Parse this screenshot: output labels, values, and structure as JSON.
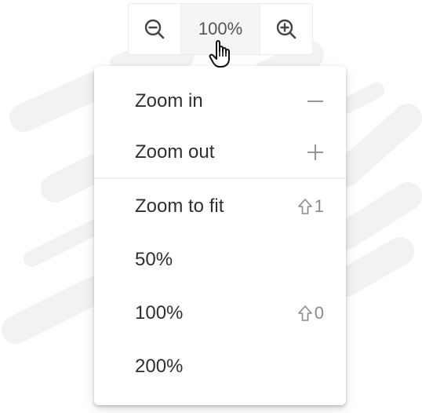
{
  "zoom_bar": {
    "level": "100%",
    "zoom_out_icon": "zoom-out-magnifier-icon",
    "zoom_in_icon": "zoom-in-magnifier-icon"
  },
  "cursor_icon": "hand-pointer-icon",
  "menu": {
    "items": [
      {
        "label": "Zoom in",
        "shortcut_icon": "minus-icon",
        "shortcut_key": ""
      },
      {
        "label": "Zoom out",
        "shortcut_icon": "plus-icon",
        "shortcut_key": ""
      },
      {
        "label": "Zoom to fit",
        "shortcut_icon": "shift-icon",
        "shortcut_key": "1"
      },
      {
        "label": "50%",
        "shortcut_icon": "",
        "shortcut_key": ""
      },
      {
        "label": "100%",
        "shortcut_icon": "shift-icon",
        "shortcut_key": "0"
      },
      {
        "label": "200%",
        "shortcut_icon": "",
        "shortcut_key": ""
      }
    ]
  },
  "colors": {
    "text": "#2f2f2f",
    "muted": "#8a8a8a",
    "active_bg": "#f5f5f5",
    "decoration": "#f2f2f3"
  }
}
